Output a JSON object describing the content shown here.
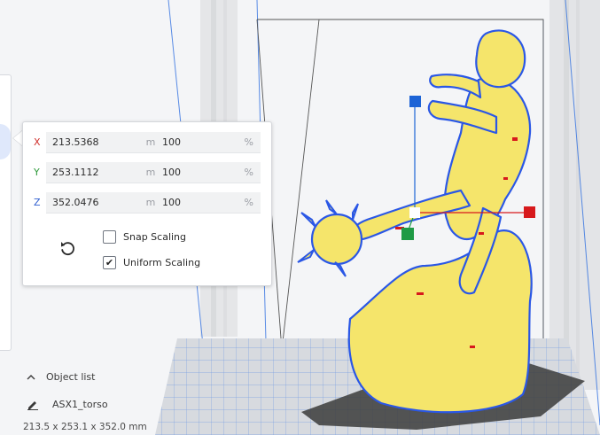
{
  "scale_panel": {
    "rows": [
      {
        "axis": "X",
        "axis_color": "#d0312d",
        "value_mm": "213.5368",
        "unit_mm": "mm",
        "value_pct": "100",
        "unit_pct": "%"
      },
      {
        "axis": "Y",
        "axis_color": "#2e9a3a",
        "value_mm": "253.1112",
        "unit_mm": "mm",
        "value_pct": "100",
        "unit_pct": "%"
      },
      {
        "axis": "Z",
        "axis_color": "#2f5fd0",
        "value_mm": "352.0476",
        "unit_mm": "mm",
        "value_pct": "100",
        "unit_pct": "%"
      }
    ],
    "snap_scaling": {
      "label": "Snap Scaling",
      "checked": false
    },
    "uniform_scaling": {
      "label": "Uniform Scaling",
      "checked": true,
      "check_glyph": "✔"
    },
    "reset_icon": "undo-arrow-icon"
  },
  "object_list": {
    "label": "Object list",
    "icon": "chevron-up-icon"
  },
  "selected_object": {
    "name": "ASX1_torso",
    "icon": "pencil-icon"
  },
  "dimensions": "213.5 x 253.1 x 352.0 mm",
  "colors": {
    "model_fill": "#f5e56b",
    "model_outline": "#2a57e6",
    "gizmo_red": "#d7191c",
    "gizmo_green": "#1f9a45",
    "gizmo_blue": "#1c63d6",
    "grid_line": "#2f6fe0"
  }
}
